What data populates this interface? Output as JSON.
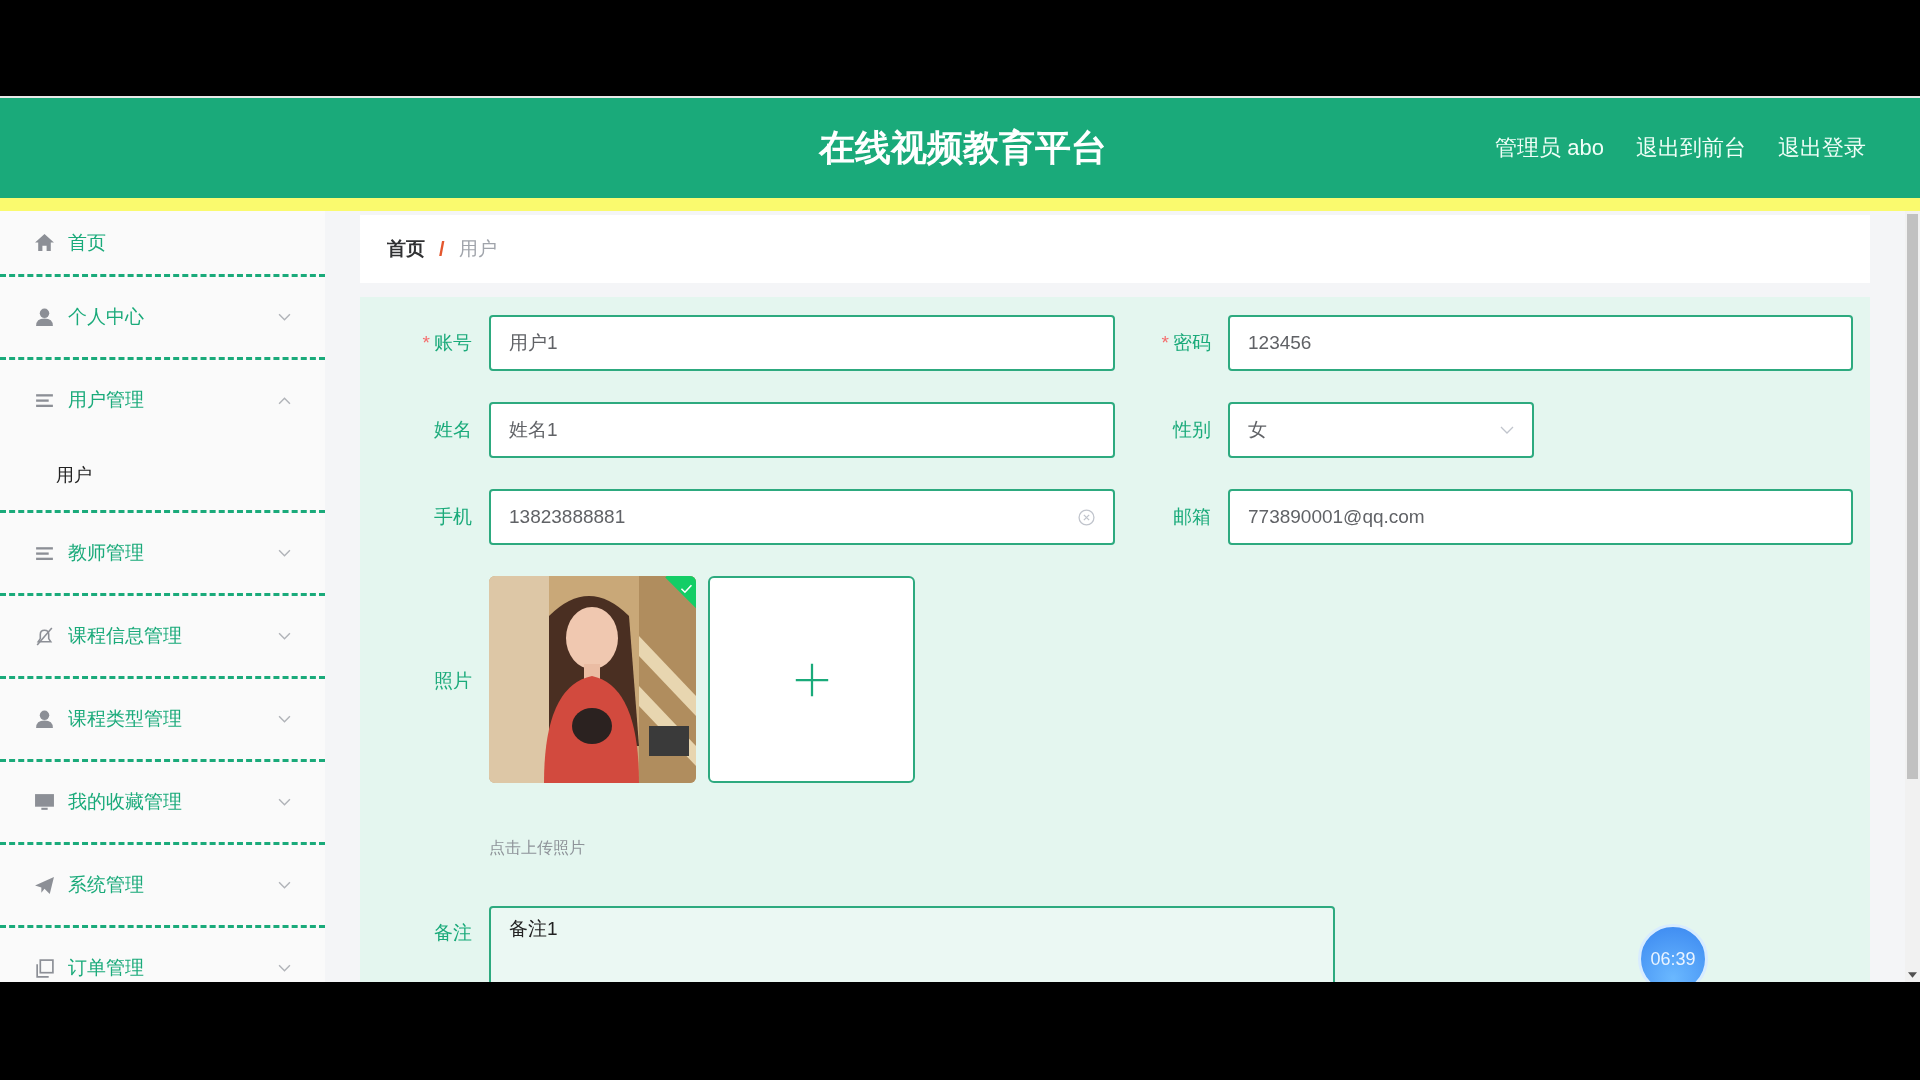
{
  "header": {
    "title": "在线视频教育平台",
    "links": [
      "管理员 abo",
      "退出到前台",
      "退出登录"
    ]
  },
  "sidebar": {
    "items": [
      {
        "kind": "link",
        "label": "首页"
      },
      {
        "kind": "menu",
        "label": "个人中心",
        "expanded": false
      },
      {
        "kind": "menu",
        "label": "用户管理",
        "expanded": true,
        "children": [
          {
            "label": "用户"
          }
        ]
      },
      {
        "kind": "menu",
        "label": "教师管理",
        "expanded": false
      },
      {
        "kind": "menu",
        "label": "课程信息管理",
        "expanded": false
      },
      {
        "kind": "menu",
        "label": "课程类型管理",
        "expanded": false
      },
      {
        "kind": "menu",
        "label": "我的收藏管理",
        "expanded": false
      },
      {
        "kind": "menu",
        "label": "系统管理",
        "expanded": false
      },
      {
        "kind": "menu",
        "label": "订单管理",
        "expanded": false
      }
    ]
  },
  "breadcrumb": {
    "items": [
      "首页",
      "用户"
    ],
    "separator": "/"
  },
  "form": {
    "required_mark": "*",
    "rows": [
      [
        {
          "kind": "input",
          "label": "账号",
          "required": true,
          "value": "用户1"
        },
        {
          "kind": "input",
          "label": "密码",
          "required": true,
          "value": "123456"
        }
      ],
      [
        {
          "kind": "input",
          "label": "姓名",
          "required": false,
          "value": "姓名1"
        },
        {
          "kind": "select",
          "label": "性别",
          "required": false,
          "value": "女"
        }
      ],
      [
        {
          "kind": "input",
          "label": "手机",
          "required": false,
          "value": "13823888881",
          "clearable": true
        },
        {
          "kind": "input",
          "label": "邮箱",
          "required": false,
          "value": "773890001@qq.com"
        }
      ],
      [
        {
          "kind": "upload",
          "label": "照片",
          "required": false,
          "uploaded": true,
          "hint": "点击上传照片"
        }
      ],
      [
        {
          "kind": "textarea",
          "label": "备注",
          "required": false,
          "value": "备注1"
        }
      ]
    ]
  },
  "timer": "06:39"
}
